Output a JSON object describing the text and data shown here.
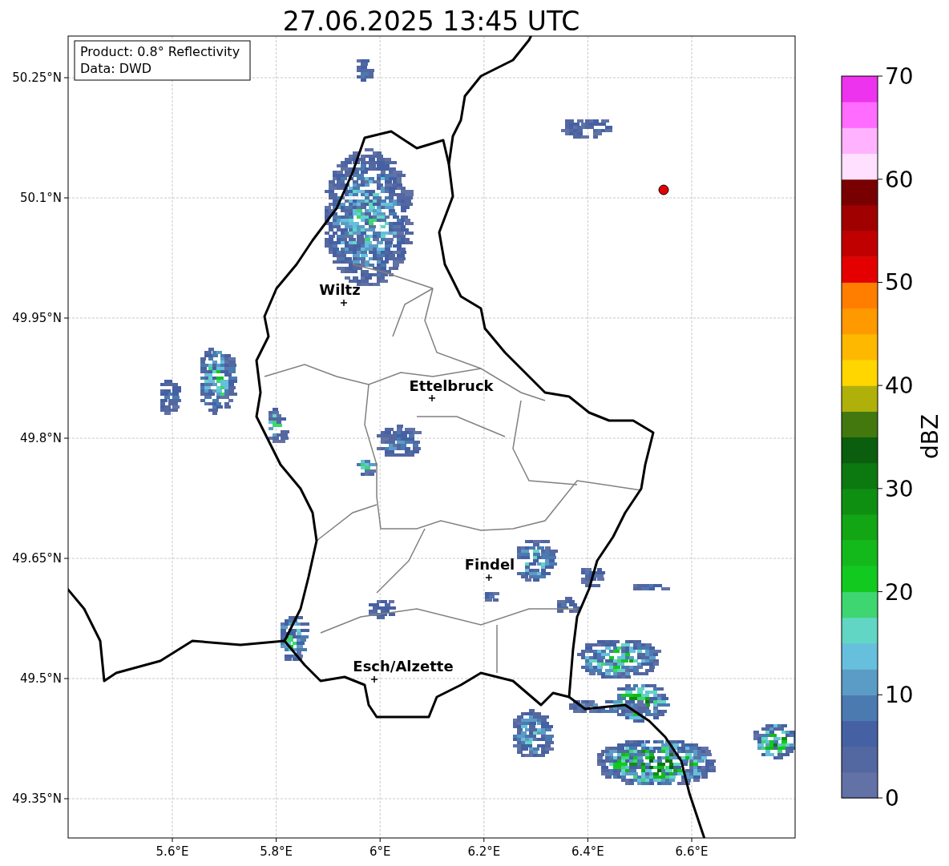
{
  "title": "27.06.2025 13:45 UTC",
  "info_box": [
    "Product: 0.8° Reflectivity",
    "Data: DWD"
  ],
  "map": {
    "lat_labels": [
      "50.25°N",
      "50.1°N",
      "49.95°N",
      "49.8°N",
      "49.65°N",
      "49.5°N",
      "49.35°N"
    ],
    "lon_labels": [
      "5.6°E",
      "5.8°E",
      "6°E",
      "6.2°E",
      "6.4°E",
      "6.6°E"
    ],
    "cities": [
      {
        "name": "Wiltz"
      },
      {
        "name": "Ettelbruck"
      },
      {
        "name": "Findel"
      },
      {
        "name": "Esch/Alzette"
      }
    ]
  },
  "colorbar": {
    "label": "dBZ",
    "ticks": [
      "70",
      "60",
      "50",
      "40",
      "30",
      "20",
      "10",
      "0"
    ],
    "segments": [
      {
        "color": "#6272a6"
      },
      {
        "color": "#5367a0"
      },
      {
        "color": "#4561a3"
      },
      {
        "color": "#4b7ab0"
      },
      {
        "color": "#5b9cc6"
      },
      {
        "color": "#66bfdd"
      },
      {
        "color": "#62d6c4"
      },
      {
        "color": "#3ed671"
      },
      {
        "color": "#12c91f"
      },
      {
        "color": "#13b91a"
      },
      {
        "color": "#12a514"
      },
      {
        "color": "#0f8f12"
      },
      {
        "color": "#0c7810"
      },
      {
        "color": "#0a5e0d"
      },
      {
        "color": "#42780e"
      },
      {
        "color": "#b0b00a"
      },
      {
        "color": "#ffd600"
      },
      {
        "color": "#ffb800"
      },
      {
        "color": "#ff9900"
      },
      {
        "color": "#ff7e00"
      },
      {
        "color": "#e40000"
      },
      {
        "color": "#c00000"
      },
      {
        "color": "#a00000"
      },
      {
        "color": "#780000"
      },
      {
        "color": "#ffe0ff"
      },
      {
        "color": "#ffb3ff"
      },
      {
        "color": "#ff6cff"
      },
      {
        "color": "#ee33ee"
      }
    ]
  }
}
